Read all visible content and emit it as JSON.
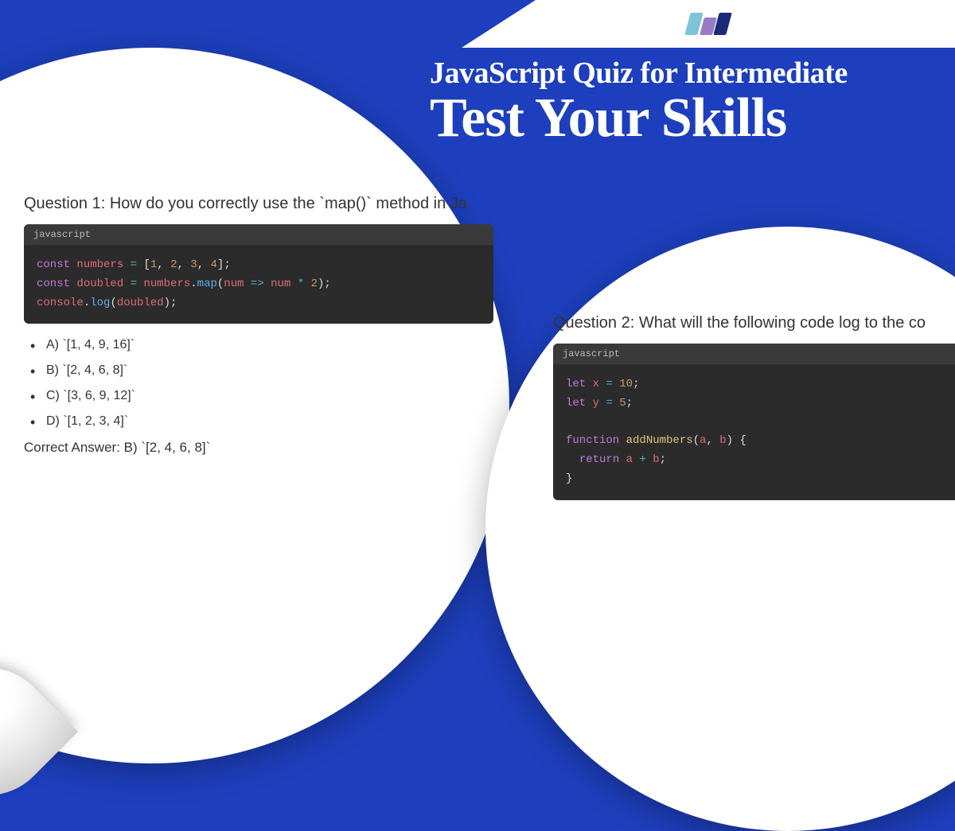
{
  "banner": {
    "logo_alt": "logo"
  },
  "heading": {
    "line1": "JavaScript Quiz for Intermediate",
    "line2": "Test Your Skills"
  },
  "question1": {
    "title": "Question 1: How do you correctly use the `map()` method in Ja",
    "code_lang": "javascript",
    "options": {
      "a": "A) `[1, 4, 9, 16]`",
      "b": "B) `[2, 4, 6, 8]`",
      "c": "C) `[3, 6, 9, 12]`",
      "d": "D) `[1, 2, 3, 4]`"
    },
    "correct": "Correct Answer: B) `[2, 4, 6, 8]`"
  },
  "question2": {
    "title": "Question 2: What will the following code log to the co",
    "code_lang": "javascript"
  }
}
